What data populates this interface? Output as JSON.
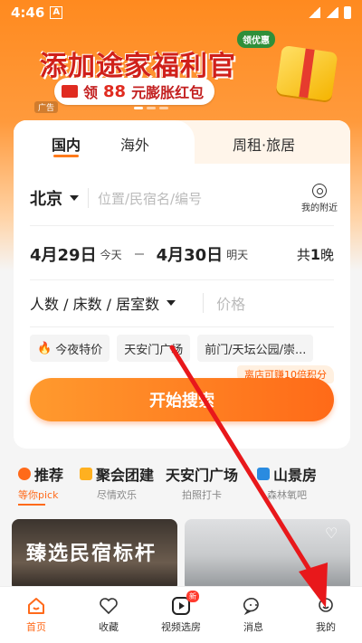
{
  "status_bar": {
    "time": "4:46",
    "a_icon": "A"
  },
  "banner": {
    "title": "添加途家福利官",
    "badge": "领优惠",
    "sub_prefix": "领",
    "sub_amount": "88",
    "sub_suffix": "元膨胀红包",
    "ad_label": "广告"
  },
  "search_card": {
    "tabs": [
      "国内",
      "海外",
      "周租·旅居"
    ],
    "city": "北京",
    "search_placeholder": "位置/民宿名/编号",
    "nearby_label": "我的附近",
    "checkin_date": "4月29日",
    "checkin_day": "今天",
    "checkout_date": "4月30日",
    "checkout_day": "明天",
    "nights_prefix": "共",
    "nights_count": "1",
    "nights_suffix": "晚",
    "people_label": "人数 / 床数 / 居室数",
    "price_placeholder": "价格",
    "chips": [
      "今夜特价",
      "天安门广场",
      "前门/天坛公园/崇..."
    ],
    "points_badge": "离店可赚10倍积分",
    "search_button": "开始搜索"
  },
  "categories": [
    {
      "title": "推荐",
      "sub": "等你pick",
      "icon_color": "#ff6a1a"
    },
    {
      "title": "聚会团建",
      "sub": "尽情欢乐",
      "icon_color": "#ffb020"
    },
    {
      "title": "天安门广场",
      "sub": "拍照打卡",
      "icon_color": ""
    },
    {
      "title": "山景房",
      "sub": "森林氧吧",
      "icon_color": "#2a8be0"
    }
  ],
  "listings": [
    {
      "title": "臻选民宿标杆"
    },
    {
      "title": ""
    }
  ],
  "bottom_nav": {
    "items": [
      "首页",
      "收藏",
      "视频选房",
      "消息",
      "我的"
    ],
    "new_badge": "新"
  },
  "accent_color": "#ff6a1a"
}
